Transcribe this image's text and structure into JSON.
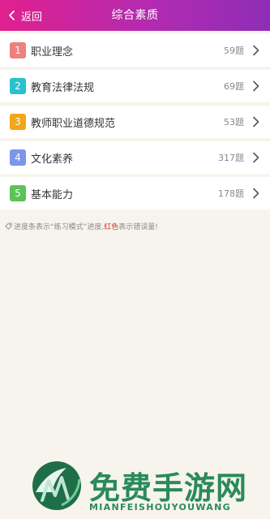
{
  "header": {
    "back_label": "返回",
    "title": "综合素质",
    "gradient_colors": [
      "#e0208e",
      "#8e2db6"
    ]
  },
  "categories": [
    {
      "index": "1",
      "label": "职业理念",
      "count": "59题",
      "color": "#ee8080"
    },
    {
      "index": "2",
      "label": "教育法律法规",
      "count": "69题",
      "color": "#27c2cc"
    },
    {
      "index": "3",
      "label": "教师职业道德规范",
      "count": "53题",
      "color": "#f2a619"
    },
    {
      "index": "4",
      "label": "文化素养",
      "count": "317题",
      "color": "#7b96ea"
    },
    {
      "index": "5",
      "label": "基本能力",
      "count": "178题",
      "color": "#5cc356"
    }
  ],
  "note": {
    "prefix": "进度条表示“练习模式”进度,",
    "highlight": "红色",
    "suffix": "表示错误量!"
  },
  "watermark": {
    "cn": "免费手游网",
    "en": "MIANFEISHOUYOUWANG"
  }
}
